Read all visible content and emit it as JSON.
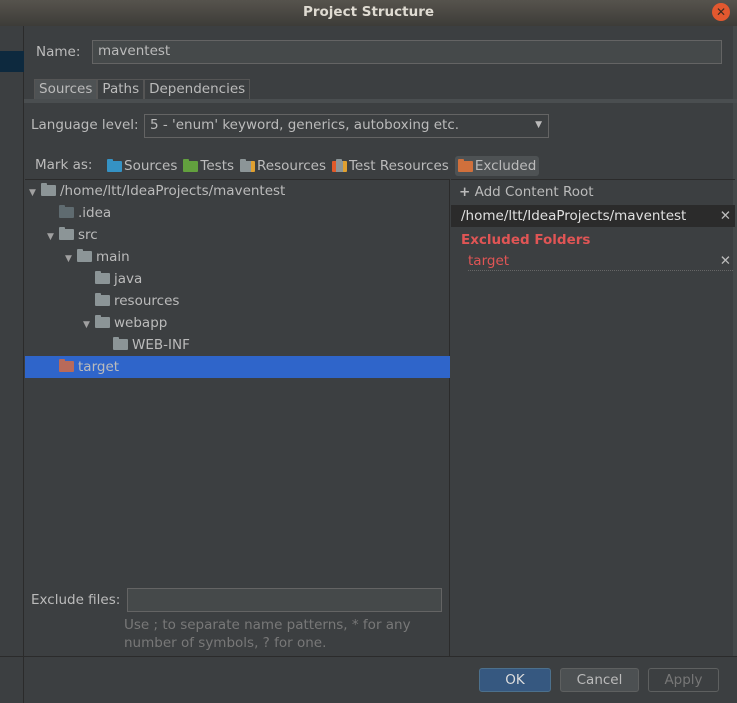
{
  "window": {
    "title": "Project Structure"
  },
  "name": {
    "label": "Name:",
    "value": "maventest"
  },
  "tabs": [
    {
      "label": "Sources"
    },
    {
      "label": "Paths"
    },
    {
      "label": "Dependencies"
    }
  ],
  "language": {
    "label": "Language level:",
    "value": "5 - 'enum' keyword, generics, autoboxing etc."
  },
  "mark_as": {
    "label": "Mark as:",
    "items": [
      {
        "label": "Sources",
        "color": "#3592c4"
      },
      {
        "label": "Tests",
        "color": "#62a03e"
      },
      {
        "label": "Resources",
        "color": "#8c9597"
      },
      {
        "label": "Test Resources",
        "color": "#8c9597"
      },
      {
        "label": "Excluded",
        "color": "#d0703c"
      }
    ]
  },
  "tree": [
    {
      "label": "/home/ltt/IdeaProjects/maventest",
      "depth": 0,
      "expanded": true
    },
    {
      "label": ".idea",
      "depth": 1
    },
    {
      "label": "src",
      "depth": 1,
      "expanded": true
    },
    {
      "label": "main",
      "depth": 2,
      "expanded": true
    },
    {
      "label": "java",
      "depth": 3
    },
    {
      "label": "resources",
      "depth": 3
    },
    {
      "label": "webapp",
      "depth": 3,
      "expanded": true
    },
    {
      "label": "WEB-INF",
      "depth": 4
    },
    {
      "label": "target",
      "depth": 1,
      "selected": true,
      "excluded": true
    }
  ],
  "right": {
    "add_root": "Add Content Root",
    "root_path": "/home/ltt/IdeaProjects/maventest",
    "excluded_title": "Excluded Folders",
    "excluded_items": [
      "target"
    ],
    "excluded_color": "#e05555"
  },
  "exclude_files": {
    "label": "Exclude files:",
    "value": "",
    "hint_line1": "Use ; to separate name patterns, * for any",
    "hint_line2": "number of symbols, ? for one."
  },
  "buttons": {
    "ok": "OK",
    "cancel": "Cancel",
    "apply": "Apply"
  }
}
